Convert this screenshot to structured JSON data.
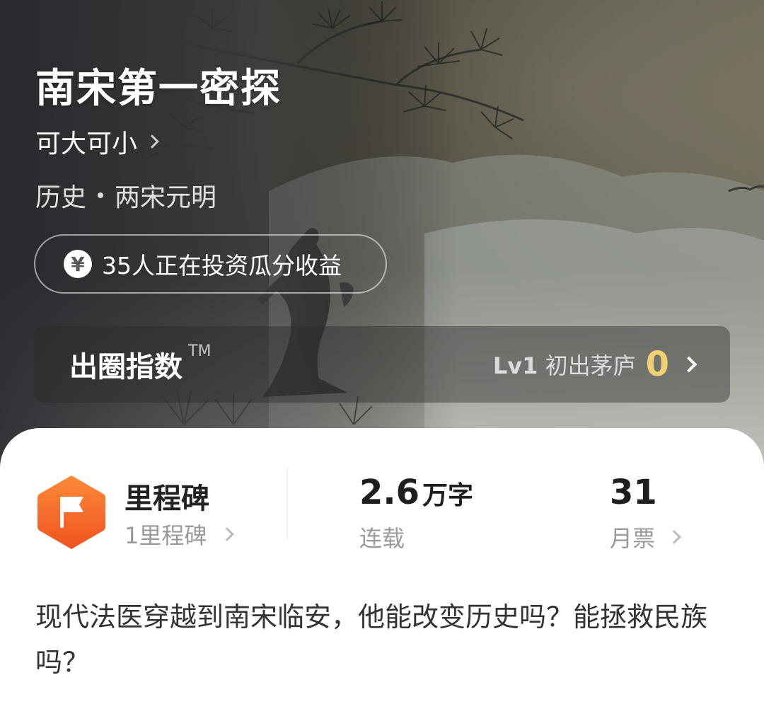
{
  "book": {
    "title": "南宋第一密探",
    "author": "可大可小",
    "genre": "历史",
    "subgenre": "两宋元明"
  },
  "invest": {
    "icon": "yen-icon",
    "label": "35人正在投资瓜分收益"
  },
  "index": {
    "label": "出圈指数",
    "trademark": "TM",
    "level_code": "Lv1",
    "level_name": "初出茅庐",
    "score": "0"
  },
  "stats": {
    "milestone": {
      "icon": "flag-icon",
      "title": "里程碑",
      "sub": "1里程碑"
    },
    "words": {
      "value": "2.6",
      "unit": "万字",
      "label": "连载"
    },
    "tickets": {
      "value": "31",
      "label": "月票"
    }
  },
  "synopsis": "现代法医穿越到南宋临安，他能改变历史吗？能拯救民族吗？",
  "colors": {
    "score": "#f0d070",
    "milestone_orange": "#f26a2a"
  }
}
